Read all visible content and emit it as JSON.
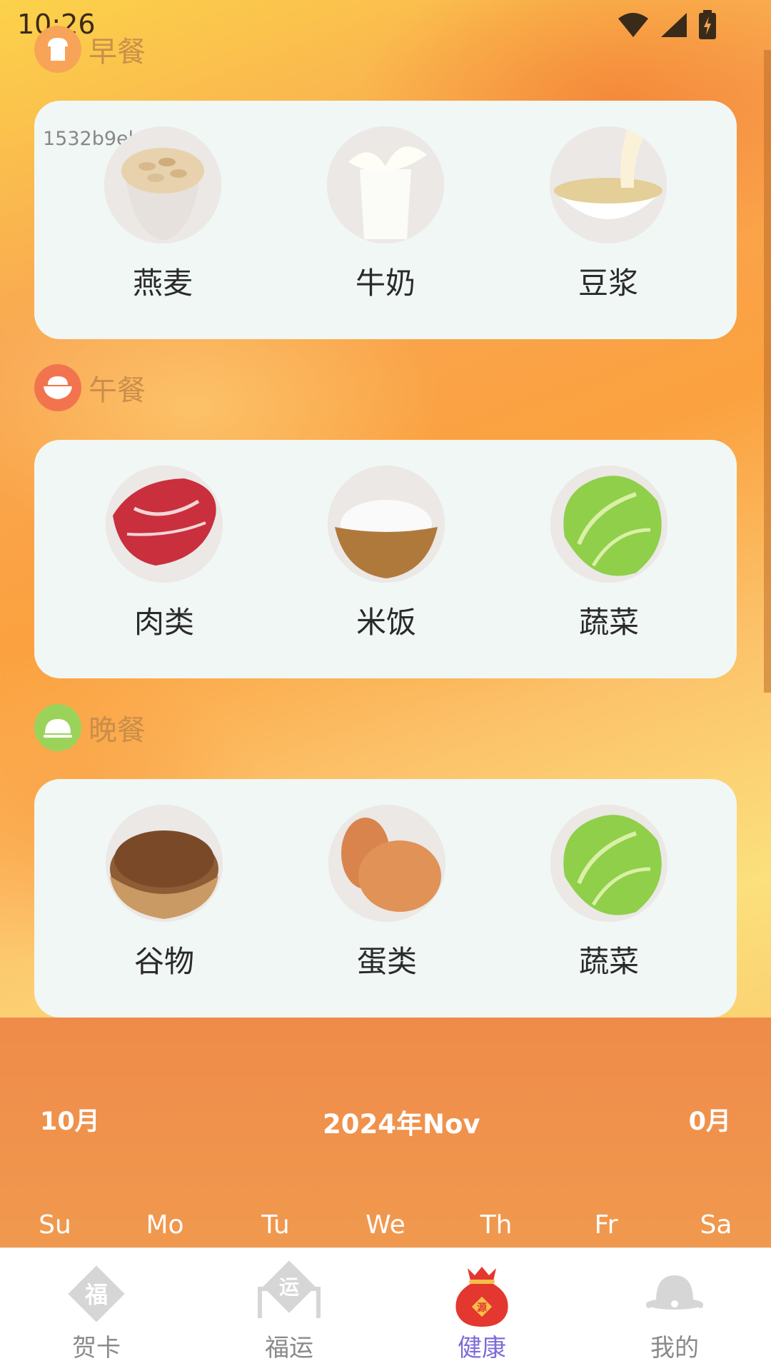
{
  "status_bar": {
    "time": "10:26"
  },
  "debug_tag": "1532b9eb",
  "meals": [
    {
      "title": "早餐",
      "icon": "bread-icon",
      "foods": [
        {
          "label": "燕麦",
          "image": "oats-image"
        },
        {
          "label": "牛奶",
          "image": "milk-image"
        },
        {
          "label": "豆浆",
          "image": "soymilk-image"
        }
      ]
    },
    {
      "title": "午餐",
      "icon": "rice-bowl-icon",
      "foods": [
        {
          "label": "肉类",
          "image": "meat-image"
        },
        {
          "label": "米饭",
          "image": "rice-image"
        },
        {
          "label": "蔬菜",
          "image": "lettuce-image"
        }
      ]
    },
    {
      "title": "晚餐",
      "icon": "cloche-icon",
      "foods": [
        {
          "label": "谷物",
          "image": "grain-image"
        },
        {
          "label": "蛋类",
          "image": "eggs-image"
        },
        {
          "label": "蔬菜",
          "image": "lettuce-image"
        }
      ]
    }
  ],
  "calendar": {
    "prev_label": "10月",
    "title": "2024年Nov",
    "next_label": "0月",
    "weekdays": [
      "Su",
      "Mo",
      "Tu",
      "We",
      "Th",
      "Fr",
      "Sa"
    ]
  },
  "bottom_nav": {
    "active_index": 2,
    "items": [
      {
        "label": "贺卡",
        "icon": "fu-card-icon",
        "glyph": "福"
      },
      {
        "label": "福运",
        "icon": "fortune-icon",
        "glyph": "运"
      },
      {
        "label": "健康",
        "icon": "lucky-bag-icon",
        "glyph": "源"
      },
      {
        "label": "我的",
        "icon": "profile-icon",
        "glyph": ""
      }
    ]
  },
  "colors": {
    "accent_active": "#7d6bd9",
    "calendar_bg": "#ef8b4a",
    "card_bg": "#f1f7f4"
  }
}
